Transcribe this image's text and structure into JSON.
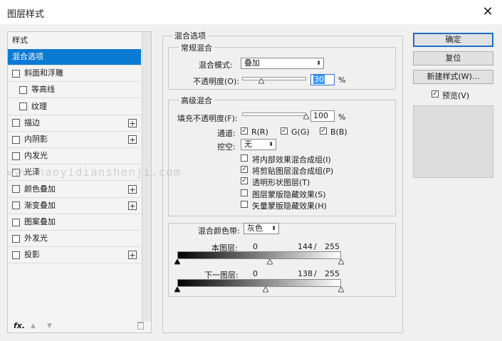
{
  "dialog": {
    "title": "图层样式",
    "close": "✕"
  },
  "styles_panel": {
    "header": "样式",
    "items": [
      {
        "label": "混合选项",
        "selected": true,
        "checkbox": false,
        "plus": false
      },
      {
        "label": "斜面和浮雕",
        "checkbox": true,
        "plus": false
      },
      {
        "label": "等高线",
        "checkbox": true,
        "plus": false,
        "indent": true
      },
      {
        "label": "纹理",
        "checkbox": true,
        "plus": false,
        "indent": true
      },
      {
        "label": "描边",
        "checkbox": true,
        "plus": true
      },
      {
        "label": "内阴影",
        "checkbox": true,
        "plus": true
      },
      {
        "label": "内发光",
        "checkbox": true,
        "plus": false
      },
      {
        "label": "光泽",
        "checkbox": true,
        "plus": false
      },
      {
        "label": "颜色叠加",
        "checkbox": true,
        "plus": true
      },
      {
        "label": "渐变叠加",
        "checkbox": true,
        "plus": true
      },
      {
        "label": "图案叠加",
        "checkbox": true,
        "plus": false
      },
      {
        "label": "外发光",
        "checkbox": true,
        "plus": false
      },
      {
        "label": "投影",
        "checkbox": true,
        "plus": true
      }
    ],
    "footer_fx": "fx."
  },
  "blend_options": {
    "title": "混合选项",
    "general": {
      "title": "常规混合",
      "mode_label": "混合模式:",
      "mode_value": "叠加",
      "opacity_label": "不透明度(O):",
      "opacity_value": "30",
      "opacity_unit": "%",
      "opacity_level": 0.3
    },
    "advanced": {
      "title": "高级混合",
      "fill_label": "填充不透明度(F):",
      "fill_value": "100",
      "fill_unit": "%",
      "fill_level": 1.0,
      "channels_label": "通道:",
      "channel_r": "R(R)",
      "channel_g": "G(G)",
      "channel_b": "B(B)",
      "knockout_label": "挖空:",
      "knockout_value": "无",
      "options": [
        {
          "label": "将内部效果混合成组(I)",
          "checked": false
        },
        {
          "label": "将剪贴图层混合成组(P)",
          "checked": true
        },
        {
          "label": "透明形状图层(T)",
          "checked": true
        },
        {
          "label": "图层蒙版隐藏效果(S)",
          "checked": false
        },
        {
          "label": "矢量蒙版隐藏效果(H)",
          "checked": false
        }
      ]
    },
    "blend_if": {
      "label": "混合颜色带:",
      "value": "灰色",
      "this_layer": {
        "label": "本图层:",
        "black": "0",
        "mid": "144",
        "slash": "/",
        "white": "255"
      },
      "underlying": {
        "label": "下一图层:",
        "black": "0",
        "mid": "138",
        "slash": "/",
        "white": "255"
      }
    }
  },
  "buttons": {
    "ok": "确定",
    "reset": "复位",
    "new_style": "新建样式(W)...",
    "preview": "预览(V)"
  },
  "watermark": "www.haoyidianshenji.com",
  "icons": {
    "check": "✓",
    "plus": "+",
    "dropdown": "⬍",
    "up": "▲",
    "down": "▼",
    "trash": "🗑"
  }
}
